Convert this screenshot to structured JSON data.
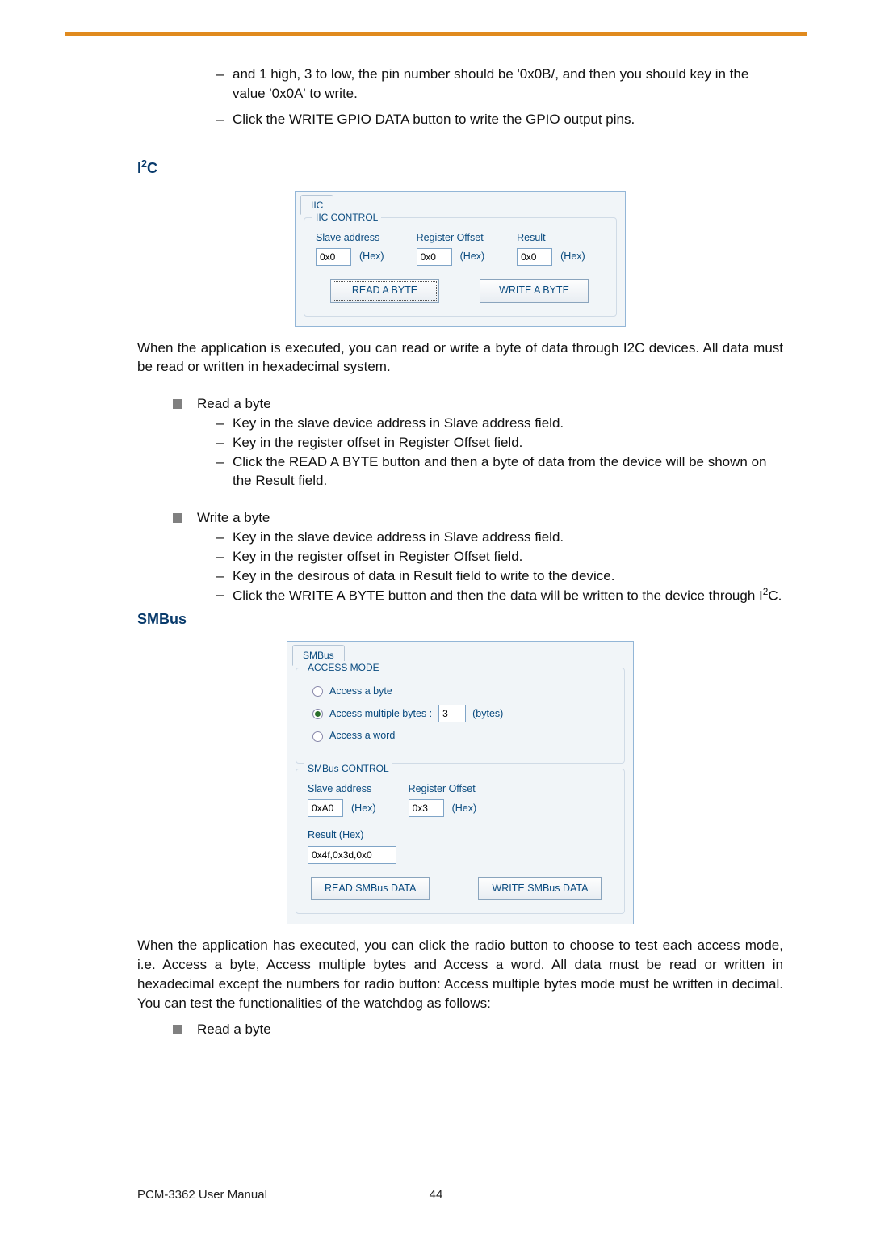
{
  "intro": {
    "bullet1": "and 1 high, 3 to low, the pin number should be '0x0B/, and then you should key in the value '0x0A' to write.",
    "bullet2": "Click the WRITE GPIO DATA button to write the GPIO output pins."
  },
  "i2c_head_a": "I",
  "i2c_head_b": "2",
  "i2c_head_c": "C",
  "iic": {
    "tab": "IIC",
    "group": "IIC CONTROL",
    "slave_label": "Slave address",
    "slave": "0x0",
    "hex": "(Hex)",
    "reg_label": "Register Offset",
    "reg": "0x0",
    "result_label": "Result",
    "result": "0x0",
    "read_btn": "READ A BYTE",
    "write_btn": "WRITE A BYTE"
  },
  "i2c_intro": "When the application is executed, you can read or write a byte of data through I2C devices. All data must be read or written in hexadecimal system.",
  "read_head": "Read a byte",
  "read_items": {
    "a": "Key in the slave device address in Slave address field.",
    "b": "Key in the register offset in Register Offset field.",
    "c": "Click the READ A BYTE button and then a byte of data from the device will be shown on the Result field."
  },
  "write_head": "Write a byte",
  "write_items": {
    "a": "Key in the slave device address in Slave address field.",
    "b": "Key in the register offset in Register Offset field.",
    "c": "Key in the desirous of data in Result field to write to the device.",
    "d_a": "Click the WRITE A BYTE button and then the data will be written to the device through I",
    "d_b": "2",
    "d_c": "C."
  },
  "smbus_head": "SMBus",
  "smbus": {
    "tab": "SMBus",
    "mode_group": "ACCESS MODE",
    "radio_byte": "Access a byte",
    "radio_multi": "Access multiple bytes :",
    "multi_val": "3",
    "bytes_label": "(bytes)",
    "radio_word": "Access a word",
    "ctrl_group": "SMBus CONTROL",
    "slave_label": "Slave address",
    "slave": "0xA0",
    "hex": "(Hex)",
    "reg_label": "Register Offset",
    "reg": "0x3",
    "result_label": "Result (Hex)",
    "result": "0x4f,0x3d,0x0",
    "read_btn": "READ SMBus DATA",
    "write_btn": "WRITE SMBus DATA"
  },
  "smbus_intro": "When the application has executed, you can click the radio button to choose to test each access mode, i.e. Access a byte, Access multiple bytes and Access a word. All data must be read or written in hexadecimal except the numbers for radio button: Access multiple bytes mode must be written in decimal. You can test the functionalities of the watchdog as follows:",
  "final_sq": "Read a byte",
  "footer_left": "PCM-3362 User Manual",
  "footer_page": "44"
}
